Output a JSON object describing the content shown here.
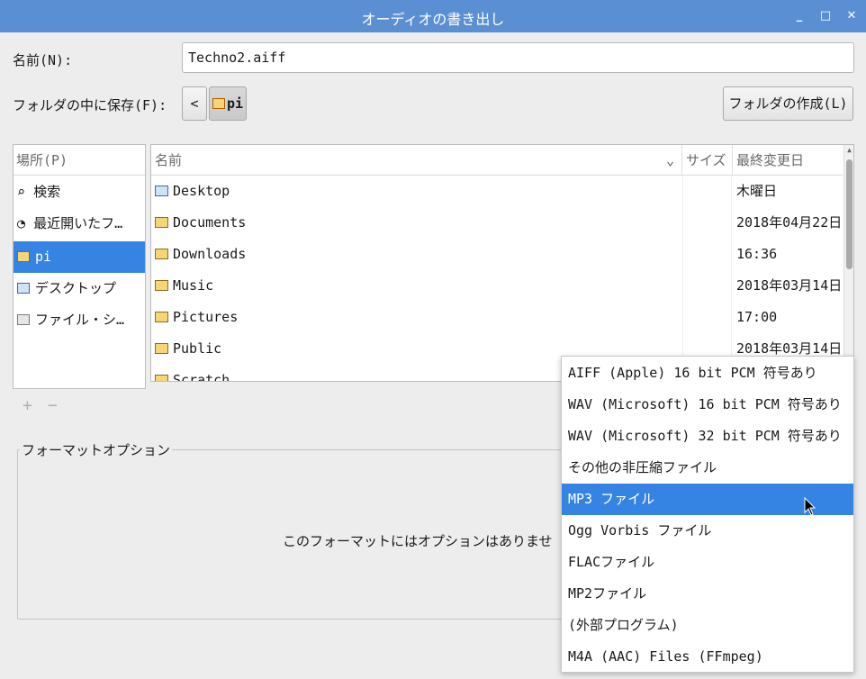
{
  "window": {
    "title": "オーディオの書き出し",
    "minimize": "_",
    "maximize": "□",
    "close": "✕"
  },
  "name_row": {
    "label": "名前(N):",
    "value": "Techno2.aiff"
  },
  "folder_row": {
    "label": "フォルダの中に保存(F):",
    "back": "<",
    "crumb": "pi",
    "create_button": "フォルダの作成(L)"
  },
  "places": {
    "header": "場所(P)",
    "items": [
      {
        "label": "検索",
        "icon": "search-icon"
      },
      {
        "label": "最近開いたフ…",
        "icon": "recent-icon"
      },
      {
        "label": "pi",
        "icon": "home-icon"
      },
      {
        "label": "デスクトップ",
        "icon": "desktop-icon"
      },
      {
        "label": "ファイル・シ…",
        "icon": "filesystem-icon"
      }
    ],
    "add": "+",
    "remove": "−"
  },
  "files": {
    "columns": {
      "name": "名前",
      "size": "サイズ",
      "modified": "最終変更日"
    },
    "rows": [
      {
        "name": "Desktop",
        "modified": "木曜日"
      },
      {
        "name": "Documents",
        "modified": "2018年04月22日"
      },
      {
        "name": "Downloads",
        "modified": "16:36"
      },
      {
        "name": "Music",
        "modified": "2018年03月14日"
      },
      {
        "name": "Pictures",
        "modified": "17:00"
      },
      {
        "name": "Public",
        "modified": "2018年03月14日"
      },
      {
        "name": "Scratch",
        "modified": ""
      }
    ]
  },
  "format_options": {
    "title": "フォーマットオプション",
    "message": "このフォーマットにはオプションはありませ"
  },
  "format_menu": {
    "items": [
      "AIFF (Apple) 16 bit PCM 符号あり",
      "WAV (Microsoft) 16 bit PCM 符号あり",
      "WAV (Microsoft) 32 bit PCM 符号あり",
      "その他の非圧縮ファイル",
      "MP3 ファイル",
      "Ogg Vorbis ファイル",
      "FLACファイル",
      "MP2ファイル",
      "(外部プログラム)",
      "M4A (AAC) Files (FFmpeg)"
    ],
    "selected_index": 4
  },
  "colors": {
    "accent": "#3584e4",
    "titlebar": "#5b8fd4"
  }
}
